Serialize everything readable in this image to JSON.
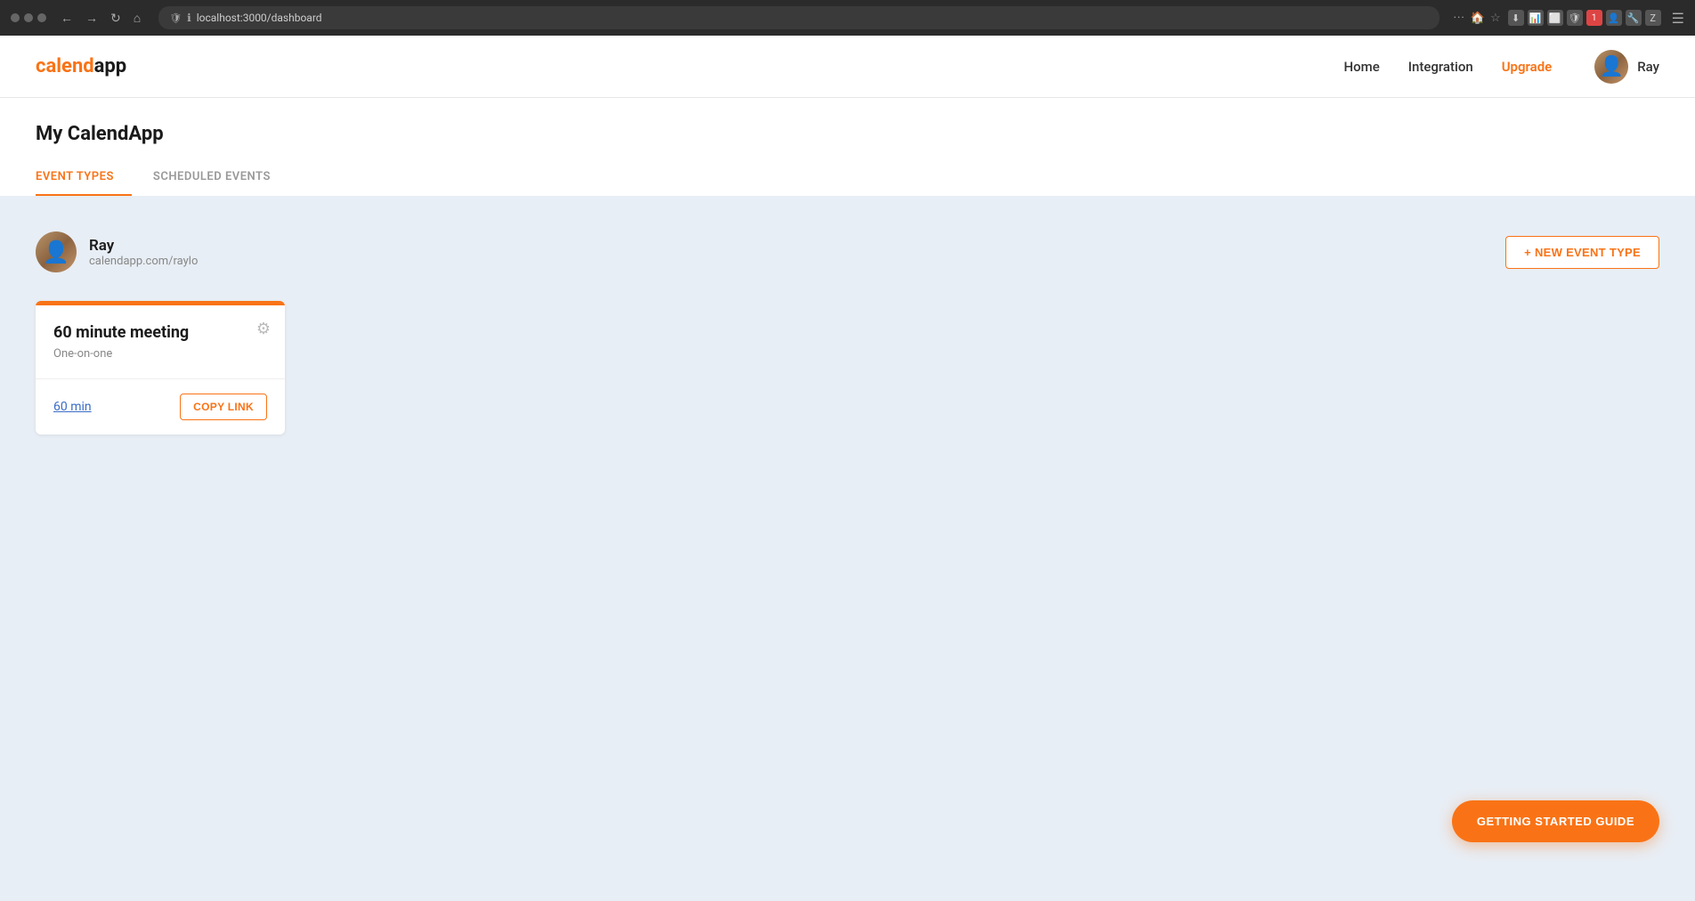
{
  "browser": {
    "url": "localhost:3000/dashboard",
    "dots_menu": "···"
  },
  "header": {
    "logo_cal": "calend",
    "logo_end": "app",
    "nav": {
      "home": "Home",
      "integration": "Integration",
      "upgrade": "Upgrade"
    },
    "user_name": "Ray"
  },
  "page": {
    "title": "My CalendApp",
    "tabs": [
      {
        "label": "EVENT TYPES",
        "active": true
      },
      {
        "label": "SCHEDULED EVENTS",
        "active": false
      }
    ]
  },
  "content": {
    "user": {
      "name": "Ray",
      "url": "calendapp.com/raylo"
    },
    "new_event_btn": "+ NEW EVENT TYPE",
    "event_card": {
      "title": "60 minute meeting",
      "type": "One-on-one",
      "duration_label": "60 min",
      "copy_btn": "COPY LINK"
    }
  },
  "getting_started": {
    "label": "GETTING STARTED GUIDE"
  }
}
